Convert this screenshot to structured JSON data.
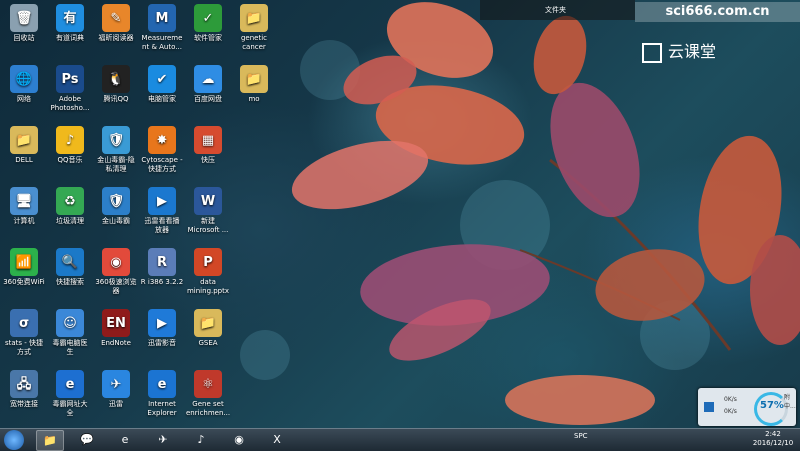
{
  "desktop": {
    "icons": [
      {
        "label": "回收站",
        "glyph": "🗑",
        "color": "#8aa0b0",
        "col": 0,
        "row": 0
      },
      {
        "label": "网络",
        "glyph": "🌐",
        "color": "#2d7fd0",
        "col": 0,
        "row": 1
      },
      {
        "label": "DELL",
        "glyph": "📁",
        "color": "#d9b95b",
        "col": 0,
        "row": 2
      },
      {
        "label": "计算机",
        "glyph": "🖥",
        "color": "#4a8fd0",
        "col": 0,
        "row": 3
      },
      {
        "label": "360免费WiFi",
        "glyph": "📶",
        "color": "#2cb14b",
        "col": 0,
        "row": 4
      },
      {
        "label": "stats - 快捷\n方式",
        "glyph": "σ",
        "color": "#3a6fb0",
        "col": 0,
        "row": 5
      },
      {
        "label": "宽带连接",
        "glyph": "🖧",
        "color": "#4a77a8",
        "col": 0,
        "row": 6
      },
      {
        "label": "有道词典",
        "glyph": "有",
        "color": "#1f8ee0",
        "col": 1,
        "row": 0
      },
      {
        "label": "Adobe\nPhotosho...",
        "glyph": "Ps",
        "color": "#1a4b8c",
        "col": 1,
        "row": 1
      },
      {
        "label": "QQ音乐",
        "glyph": "♪",
        "color": "#f0b91c",
        "col": 1,
        "row": 2
      },
      {
        "label": "垃圾清理",
        "glyph": "♻",
        "color": "#34a853",
        "col": 1,
        "row": 3
      },
      {
        "label": "快捷搜索",
        "glyph": "🔍",
        "color": "#1b79c8",
        "col": 1,
        "row": 4
      },
      {
        "label": "毒霸电脑医\n生",
        "glyph": "☺",
        "color": "#3b88d8",
        "col": 1,
        "row": 5
      },
      {
        "label": "毒霸网址大\n全",
        "glyph": "e",
        "color": "#1d6fd1",
        "col": 1,
        "row": 6
      },
      {
        "label": "福昕阅读器",
        "glyph": "✎",
        "color": "#e8862a",
        "col": 2,
        "row": 0
      },
      {
        "label": "腾讯QQ",
        "glyph": "🐧",
        "color": "#222222",
        "col": 2,
        "row": 1
      },
      {
        "label": "金山毒霸-隐\n私清理",
        "glyph": "🛡",
        "color": "#3a9bd5",
        "col": 2,
        "row": 2
      },
      {
        "label": "金山毒霸",
        "glyph": "🛡",
        "color": "#2c7fc9",
        "col": 2,
        "row": 3
      },
      {
        "label": "360极速浏览\n器",
        "glyph": "◉",
        "color": "#e24a3b",
        "col": 2,
        "row": 4
      },
      {
        "label": "EndNote",
        "glyph": "EN",
        "color": "#8f1b1b",
        "col": 2,
        "row": 5
      },
      {
        "label": "迅雷",
        "glyph": "✈",
        "color": "#2a86e0",
        "col": 2,
        "row": 6
      },
      {
        "label": "Measureme\nnt & Auto...",
        "glyph": "M",
        "color": "#2366b0",
        "col": 3,
        "row": 0
      },
      {
        "label": "电脑管家",
        "glyph": "✔",
        "color": "#1a8be0",
        "col": 3,
        "row": 1
      },
      {
        "label": "Cytoscape -\n快捷方式",
        "glyph": "✸",
        "color": "#e8761c",
        "col": 3,
        "row": 2
      },
      {
        "label": "迅雷看看播\n放器",
        "glyph": "▶",
        "color": "#1b78cf",
        "col": 3,
        "row": 3
      },
      {
        "label": "R i386 3.2.2",
        "glyph": "R",
        "color": "#5b7db8",
        "col": 3,
        "row": 4
      },
      {
        "label": "迅雷影音",
        "glyph": "▶",
        "color": "#1f7ad8",
        "col": 3,
        "row": 5
      },
      {
        "label": "Internet\nExplorer",
        "glyph": "e",
        "color": "#1b74d2",
        "col": 3,
        "row": 6
      },
      {
        "label": "软件管家",
        "glyph": "✓",
        "color": "#2d9b3a",
        "col": 4,
        "row": 0
      },
      {
        "label": "百度网盘",
        "glyph": "☁",
        "color": "#2f8de4",
        "col": 4,
        "row": 1
      },
      {
        "label": "快压",
        "glyph": "▦",
        "color": "#d64b2f",
        "col": 4,
        "row": 2
      },
      {
        "label": "新建\nMicrosoft ...",
        "glyph": "W",
        "color": "#2b579a",
        "col": 4,
        "row": 3
      },
      {
        "label": "data\nmining.pptx",
        "glyph": "P",
        "color": "#d24726",
        "col": 4,
        "row": 4
      },
      {
        "label": "GSEA",
        "glyph": "📁",
        "color": "#d9b95b",
        "col": 4,
        "row": 5
      },
      {
        "label": "Gene set\nenrichmen...",
        "glyph": "⚛",
        "color": "#c0392b",
        "col": 4,
        "row": 6
      },
      {
        "label": "genetic\ncancer",
        "glyph": "📁",
        "color": "#d9b95b",
        "col": 5,
        "row": 0
      },
      {
        "label": "mo",
        "glyph": "📁",
        "color": "#d9b95b",
        "col": 5,
        "row": 1
      }
    ]
  },
  "topbar": {
    "folder_label": "文件夹"
  },
  "watermark": {
    "site": "sci666.com.cn",
    "brand": "云课堂"
  },
  "netwidget": {
    "percent": "57%",
    "up": "0K/s",
    "down": "0K/s",
    "tip": "附中..."
  },
  "taskbar": {
    "apps": [
      {
        "name": "explorer",
        "glyph": "📁",
        "active": true
      },
      {
        "name": "wechat",
        "glyph": "💬",
        "active": false
      },
      {
        "name": "ie",
        "glyph": "e",
        "active": false
      },
      {
        "name": "thunder",
        "glyph": "✈",
        "active": false
      },
      {
        "name": "qqmusic",
        "glyph": "♪",
        "active": false
      },
      {
        "name": "chrome",
        "glyph": "◉",
        "active": false
      },
      {
        "name": "excel",
        "glyph": "X",
        "active": false
      }
    ],
    "tray_text": "SPC",
    "time": "2:42",
    "date": "2016/12/10"
  }
}
